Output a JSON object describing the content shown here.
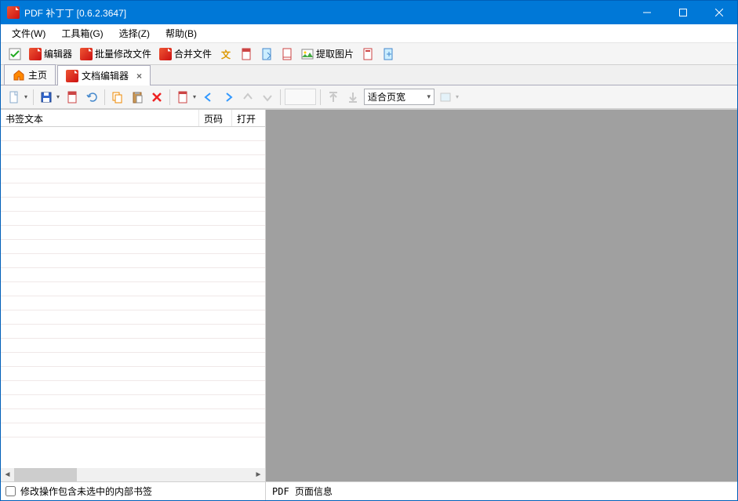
{
  "title": "PDF 补丁丁  [0.6.2.3647]",
  "menubar": {
    "file": "文件(W)",
    "toolbox": "工具箱(G)",
    "select": "选择(Z)",
    "help": "帮助(B)"
  },
  "toolbar": {
    "editor": "编辑器",
    "batch_modify": "批量修改文件",
    "merge_files": "合并文件",
    "extract_images": "提取图片"
  },
  "tabs": {
    "home": "主页",
    "doc_editor": "文档编辑器"
  },
  "editor_toolbar": {
    "zoom_mode": "适合页宽"
  },
  "left_panel": {
    "col_bookmark": "书签文本",
    "col_page": "页码",
    "col_open": "打开",
    "checkbox_label": "修改操作包含未选中的内部书签"
  },
  "right_panel": {
    "status": "PDF 页面信息"
  }
}
